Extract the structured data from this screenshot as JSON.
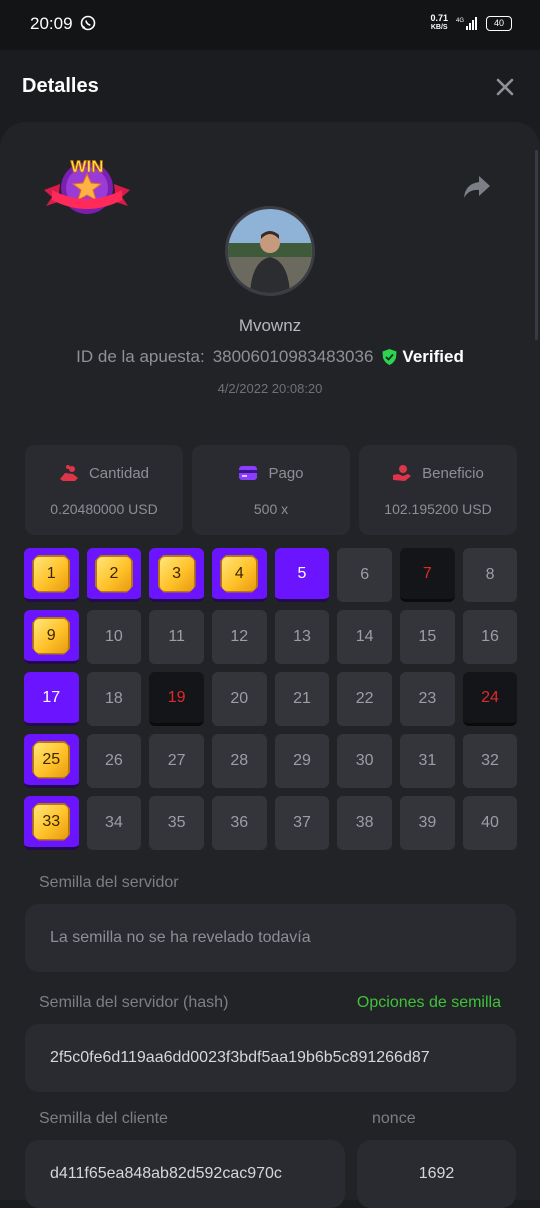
{
  "status_bar": {
    "time": "20:09",
    "net_speed_value": "0.71",
    "net_speed_unit": "KB/S",
    "battery": "40"
  },
  "header": {
    "title": "Detalles"
  },
  "profile": {
    "badge_text": "WIN",
    "username": "Mvownz",
    "bet_id_label": "ID de la apuesta:",
    "bet_id": "38006010983483036",
    "verified": "Verified",
    "date": "4/2/2022 20:08:20"
  },
  "stats": [
    {
      "label": "Cantidad",
      "value": "0.20480000 USD",
      "icon": "coins-icon"
    },
    {
      "label": "Pago",
      "value": "500 x",
      "icon": "card-icon"
    },
    {
      "label": "Beneficio",
      "value": "102.195200 USD",
      "icon": "hand-icon"
    }
  ],
  "grid": {
    "cells": [
      {
        "n": "1",
        "state": "gem"
      },
      {
        "n": "2",
        "state": "gem"
      },
      {
        "n": "3",
        "state": "gem"
      },
      {
        "n": "4",
        "state": "gem"
      },
      {
        "n": "5",
        "state": "sel"
      },
      {
        "n": "6",
        "state": "plain"
      },
      {
        "n": "7",
        "state": "bomb"
      },
      {
        "n": "8",
        "state": "plain"
      },
      {
        "n": "9",
        "state": "gem"
      },
      {
        "n": "10",
        "state": "plain"
      },
      {
        "n": "11",
        "state": "plain"
      },
      {
        "n": "12",
        "state": "plain"
      },
      {
        "n": "13",
        "state": "plain"
      },
      {
        "n": "14",
        "state": "plain"
      },
      {
        "n": "15",
        "state": "plain"
      },
      {
        "n": "16",
        "state": "plain"
      },
      {
        "n": "17",
        "state": "sel"
      },
      {
        "n": "18",
        "state": "plain"
      },
      {
        "n": "19",
        "state": "bomb"
      },
      {
        "n": "20",
        "state": "plain"
      },
      {
        "n": "21",
        "state": "plain"
      },
      {
        "n": "22",
        "state": "plain"
      },
      {
        "n": "23",
        "state": "plain"
      },
      {
        "n": "24",
        "state": "bomb"
      },
      {
        "n": "25",
        "state": "gem"
      },
      {
        "n": "26",
        "state": "plain"
      },
      {
        "n": "27",
        "state": "plain"
      },
      {
        "n": "28",
        "state": "plain"
      },
      {
        "n": "29",
        "state": "plain"
      },
      {
        "n": "30",
        "state": "plain"
      },
      {
        "n": "31",
        "state": "plain"
      },
      {
        "n": "32",
        "state": "plain"
      },
      {
        "n": "33",
        "state": "gem"
      },
      {
        "n": "34",
        "state": "plain"
      },
      {
        "n": "35",
        "state": "plain"
      },
      {
        "n": "36",
        "state": "plain"
      },
      {
        "n": "37",
        "state": "plain"
      },
      {
        "n": "38",
        "state": "plain"
      },
      {
        "n": "39",
        "state": "plain"
      },
      {
        "n": "40",
        "state": "plain"
      }
    ]
  },
  "seeds": {
    "server_label": "Semilla del servidor",
    "server_value": "La semilla no se ha revelado todavía",
    "server_hash_label": "Semilla del servidor (hash)",
    "options_link": "Opciones de semilla",
    "server_hash_value": "2f5c0fe6d119aa6dd0023f3bdf5aa19b6b5c891266d87",
    "client_label": "Semilla del cliente",
    "client_value": "d411f65ea848ab82d592cac970c",
    "nonce_label": "nonce",
    "nonce_value": "1692"
  },
  "colors": {
    "accent": "#6b14ff",
    "bomb": "#e02a2a",
    "link": "#3fc23a",
    "verified": "#2ed34f"
  }
}
